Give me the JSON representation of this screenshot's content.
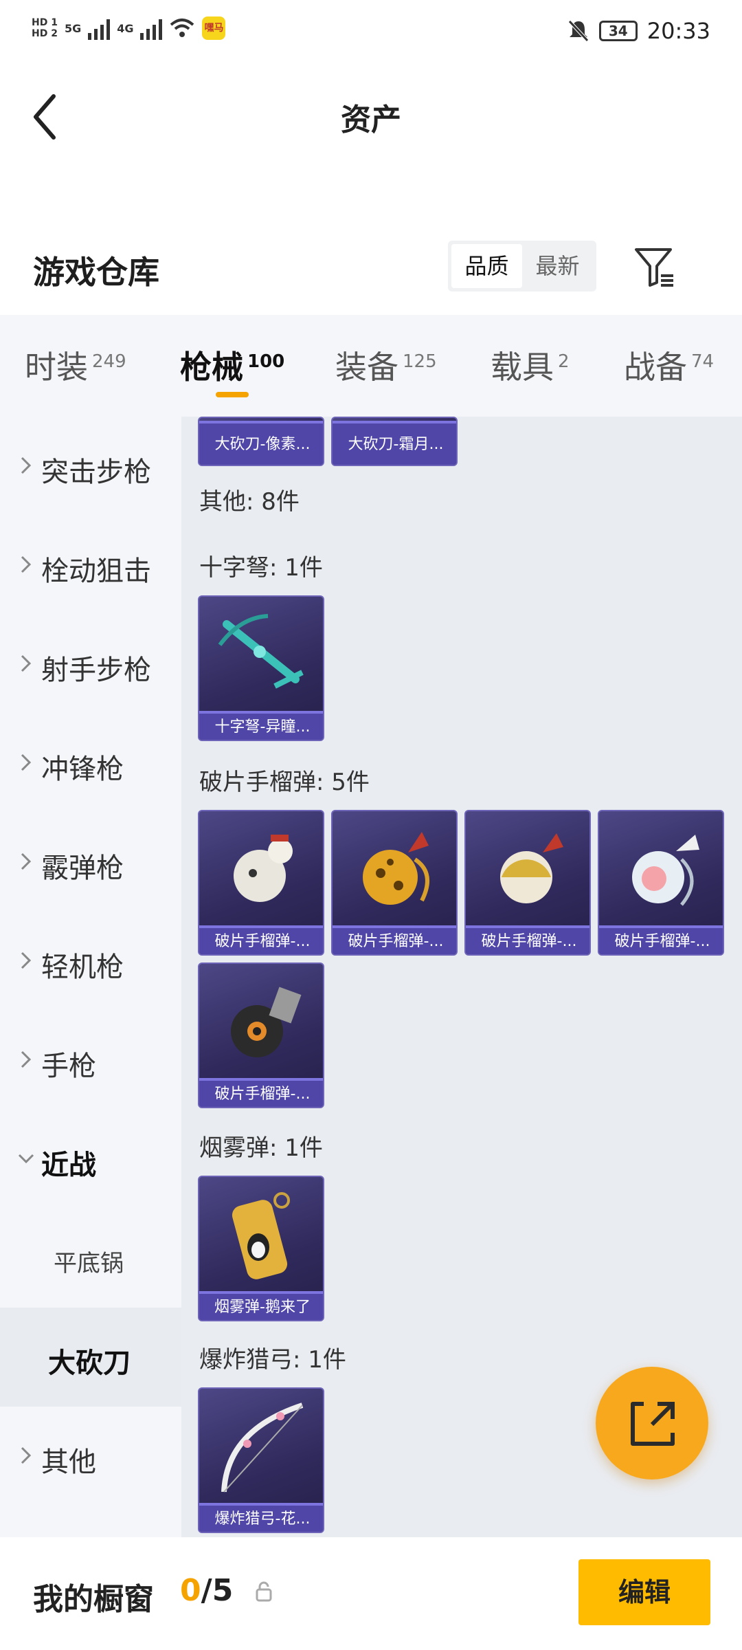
{
  "status_bar": {
    "hd1": "HD 1",
    "hd2": "HD 2",
    "sig1": "5G",
    "sig2": "4G",
    "app_badge": "嘿马",
    "battery": "34",
    "time": "20:33"
  },
  "header": {
    "title": "资产"
  },
  "warehouse": {
    "title": "游戏仓库",
    "sort_options": [
      "品质",
      "最新"
    ],
    "sort_active": "品质"
  },
  "tabs": [
    {
      "label": "时装",
      "count": "249"
    },
    {
      "label": "枪械",
      "count": "100"
    },
    {
      "label": "装备",
      "count": "125"
    },
    {
      "label": "载具",
      "count": "2"
    },
    {
      "label": "战备",
      "count": "74"
    }
  ],
  "sidebar": {
    "items": [
      {
        "label": "突击步枪"
      },
      {
        "label": "栓动狙击"
      },
      {
        "label": "射手步枪"
      },
      {
        "label": "冲锋枪"
      },
      {
        "label": "霰弹枪"
      },
      {
        "label": "轻机枪"
      },
      {
        "label": "手枪"
      },
      {
        "label": "近战"
      },
      {
        "label": "平底锅"
      },
      {
        "label": "大砍刀"
      },
      {
        "label": "其他"
      }
    ]
  },
  "content": {
    "top_cards": [
      "大砍刀-像素...",
      "大砍刀-霜月..."
    ],
    "other_header": "其他: 8件",
    "groups": [
      {
        "title": "十字弩: 1件",
        "items": [
          "十字弩-异瞳..."
        ]
      },
      {
        "title": "破片手榴弹: 5件",
        "items": [
          "破片手榴弹-...",
          "破片手榴弹-...",
          "破片手榴弹-...",
          "破片手榴弹-...",
          "破片手榴弹-..."
        ]
      },
      {
        "title": "烟雾弹: 1件",
        "items": [
          "烟雾弹-鹅来了"
        ]
      },
      {
        "title": "爆炸猎弓: 1件",
        "items": [
          "爆炸猎弓-花..."
        ]
      }
    ]
  },
  "bottom_bar": {
    "label": "我的橱窗",
    "count_current": "0",
    "count_total": "/5",
    "edit_label": "编辑"
  }
}
